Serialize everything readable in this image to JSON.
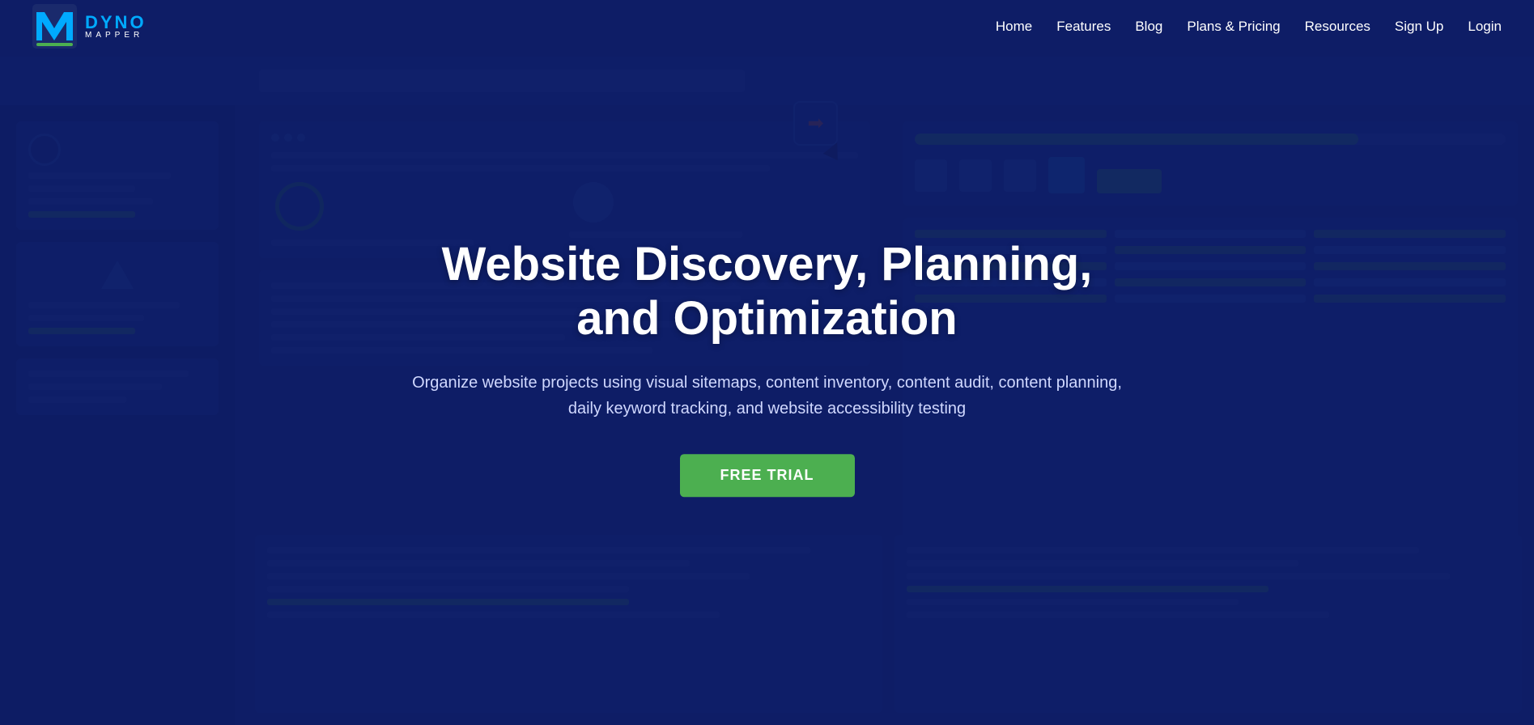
{
  "brand": {
    "logo_alt": "Dyno Mapper Logo"
  },
  "nav": {
    "links": [
      {
        "id": "home",
        "label": "Home"
      },
      {
        "id": "features",
        "label": "Features"
      },
      {
        "id": "blog",
        "label": "Blog"
      },
      {
        "id": "plans-pricing",
        "label": "Plans & Pricing"
      },
      {
        "id": "resources",
        "label": "Resources"
      },
      {
        "id": "sign-up",
        "label": "Sign Up"
      },
      {
        "id": "login",
        "label": "Login"
      }
    ]
  },
  "hero": {
    "title": "Website Discovery, Planning, and Optimization",
    "subtitle": "Organize website projects using visual sitemaps, content inventory, content audit,\ncontent planning, daily keyword tracking, and website accessibility testing",
    "cta_button": "FREE TRIAL"
  }
}
